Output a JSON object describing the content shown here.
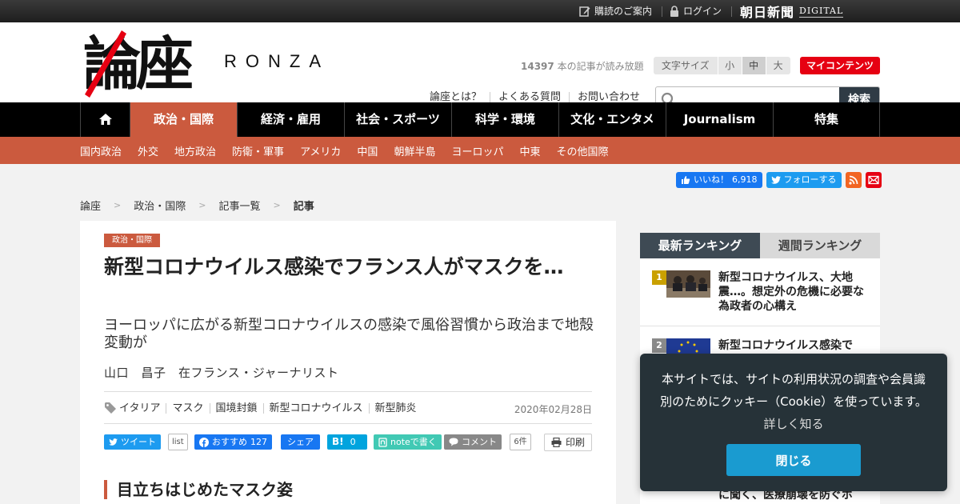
{
  "topbar": {
    "subscribe": "購読のご案内",
    "login": "ログイン",
    "asahi_name": "朝日新聞",
    "asahi_digital": "DIGITAL"
  },
  "header": {
    "logo_kanji": "論座",
    "logo_roman": "RONZA",
    "read_count_number": "14397",
    "read_count_text": " 本の記事が読み放題",
    "font_size_label": "文字サイズ",
    "font_sizes": [
      "小",
      "中",
      "大"
    ],
    "font_size_selected": "中",
    "my_contents": "マイコンテンツ",
    "links": [
      "論座とは？",
      "よくある質問",
      "お問い合わせ"
    ],
    "search_placeholder": "",
    "search_button": "検索"
  },
  "nav": {
    "items": [
      "政治・国際",
      "経済・雇用",
      "社会・スポーツ",
      "科学・環境",
      "文化・エンタメ",
      "Journalism",
      "特集"
    ],
    "active": "政治・国際",
    "sub_items": [
      "国内政治",
      "外交",
      "地方政治",
      "防衛・軍事",
      "アメリカ",
      "中国",
      "朝鮮半島",
      "ヨーロッパ",
      "中東",
      "その他国際"
    ]
  },
  "social": {
    "like_label": "いいね！",
    "like_count": "6,918",
    "follow_label": "フォローする"
  },
  "breadcrumb": [
    "論座",
    "政治・国際",
    "記事一覧",
    "記事"
  ],
  "article": {
    "category": "政治・国際",
    "title": "新型コロナウイルス感染でフランス人がマスクを…",
    "subtitle": "ヨーロッパに広がる新型コロナウイルスの感染で風俗習慣から政治まで地殻変動が",
    "author": "山口　昌子　在フランス・ジャーナリスト",
    "tags": [
      "イタリア",
      "マスク",
      "国境封鎖",
      "新型コロナウイルス",
      "新型肺炎"
    ],
    "date": "2020年02月28日",
    "share": {
      "tweet": "ツイート",
      "tweet_list": "list",
      "fb_recommend": "おすすめ",
      "fb_count": "127",
      "fb_share": "シェア",
      "hatena_count": "0",
      "note": "noteで書く",
      "comment": "コメント",
      "comment_count": "6件",
      "print": "印刷"
    },
    "section_heading": "目立ちはじめたマスク姿"
  },
  "ranking": {
    "tabs": [
      "最新ランキング",
      "週間ランキング"
    ],
    "active_tab": "最新ランキング",
    "items": [
      {
        "rank": "1",
        "title": "新型コロナウイルス、大地震…。想定外の危機に必要な為政者の心構え"
      },
      {
        "rank": "2",
        "title": "新型コロナウイルス感染で"
      }
    ],
    "partial_bottom_text": "に聞く、医療崩壊を防ぐポ"
  },
  "cookie": {
    "text": "本サイトでは、サイトの利用状況の調査や会員識別のためにクッキー（Cookie）を使っています。",
    "more": "詳しく知る",
    "close": "閉じる"
  },
  "colors": {
    "accent": "#cb5a3e",
    "brand_red": "#e60012",
    "nav_bg": "#000000",
    "cookie_bg": "#263238",
    "cookie_button": "#1a9bd0"
  }
}
